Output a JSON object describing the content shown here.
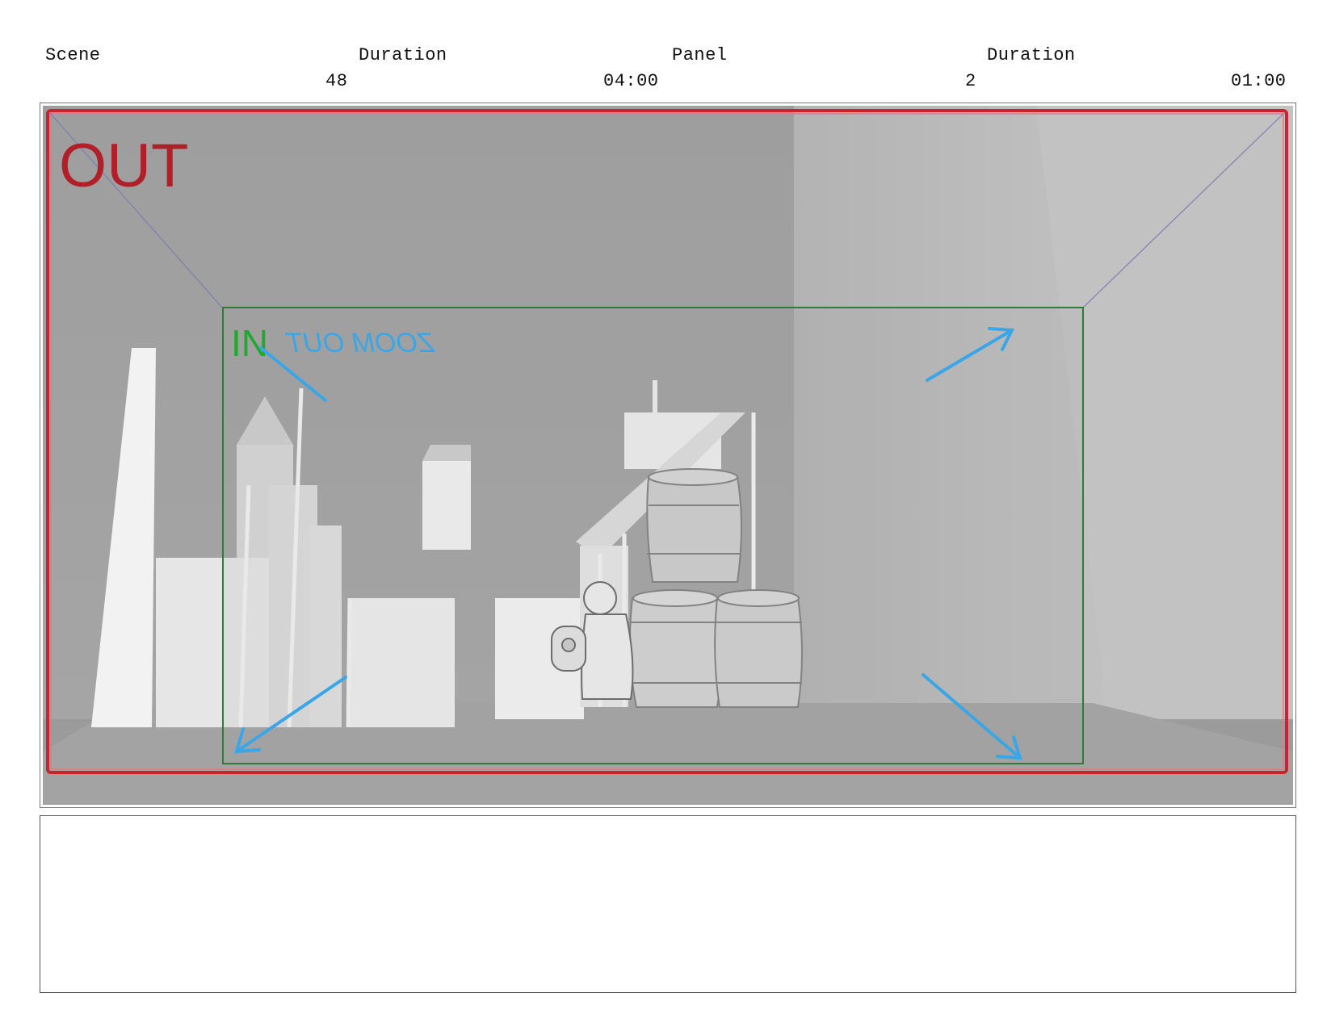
{
  "header": {
    "scene_label": "Scene",
    "duration_label_1": "Duration",
    "panel_label": "Panel",
    "duration_label_2": "Duration",
    "scene_value": "48",
    "scene_duration_value": "04:00",
    "panel_value": "2",
    "panel_duration_value": "01:00"
  },
  "panel": {
    "out_label": "OUT",
    "in_label": "IN",
    "note_text": "ZOOM OUT",
    "colors": {
      "out_frame": "#c8242e",
      "in_frame": "#2e7d32",
      "in_text": "#1faa2e",
      "annotation": "#3aa6e8",
      "background": "#a9a9a9"
    },
    "icons": [
      "arrow-up-right-icon",
      "arrow-down-left-icon",
      "arrow-down-right-icon",
      "arrow-up-left-icon",
      "barrel-icon",
      "character-sketch-icon",
      "robot-sketch-icon"
    ]
  },
  "notes": {
    "text": ""
  }
}
